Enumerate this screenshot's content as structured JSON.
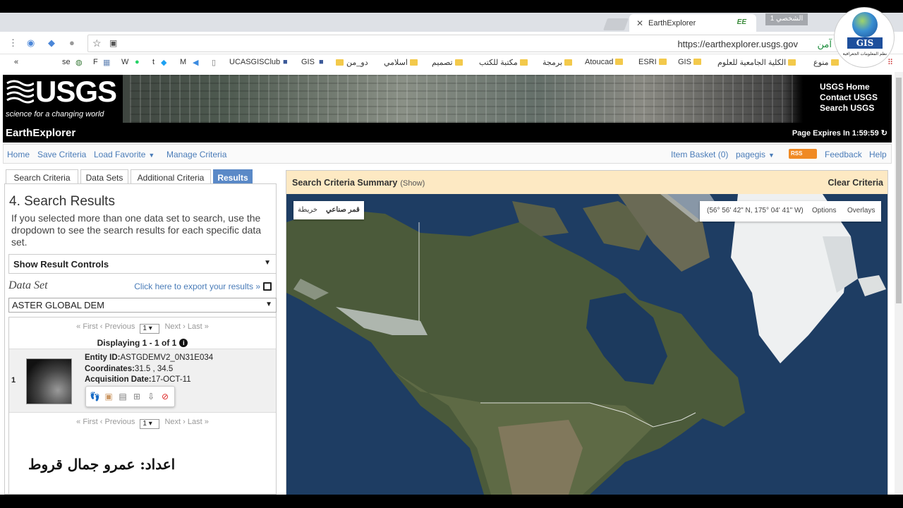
{
  "browser": {
    "tab_title": "EarthExplorer",
    "tab_badge": "EE",
    "profile_label": "الشخصي 1",
    "url": "https://earthexplorer.usgs.gov",
    "secure_label": "آمن",
    "bookmarks": [
      "se",
      "F",
      "W",
      "t",
      "M",
      "UCASGISClub",
      "GIS",
      "دو_من",
      "اسلامي",
      "تصميم",
      "مكتبة للكتب",
      "برمجة",
      "Atoucad",
      "ESRI",
      "GIS",
      "الكلية الجامعية للعلوم",
      "منوع"
    ],
    "overflow": "«"
  },
  "logo_overlay": {
    "text": "GIS",
    "subtitle": "نظم المعلومات الجغرافية"
  },
  "usgs": {
    "wordmark": "USGS",
    "tagline": "science for a changing world",
    "links": [
      "USGS Home",
      "Contact USGS",
      "Search USGS"
    ]
  },
  "app": {
    "title": "EarthExplorer",
    "expires": "Page Expires In 1:59:59",
    "nav_left": [
      "Home",
      "Save Criteria",
      "Load Favorite",
      "Manage Criteria"
    ],
    "item_basket": "Item Basket (0)",
    "user": "pagegis",
    "rss": "RSS",
    "feedback": "Feedback",
    "help": "Help"
  },
  "tabs": [
    "Search Criteria",
    "Data Sets",
    "Additional Criteria",
    "Results"
  ],
  "results": {
    "heading": "4. Search Results",
    "description": "If you selected more than one data set to search, use the dropdown to see the search results for each specific data set.",
    "show_controls": "Show Result Controls",
    "dataset_label": "Data Set",
    "export_link": "Click here to export your results »",
    "dataset_value": "ASTER GLOBAL DEM",
    "pager": {
      "first": "« First",
      "previous": "‹ Previous",
      "page": "1",
      "next": "Next ›",
      "last": "Last »"
    },
    "displaying": "Displaying 1 - 1 of 1",
    "rows": [
      {
        "index": "1",
        "entity_label": "Entity ID:",
        "entity_id": "ASTGDEMV2_0N31E034",
        "coords_label": "Coordinates:",
        "coords": "31.5 , 34.5",
        "date_label": "Acquisition Date:",
        "date": "17-OCT-11"
      }
    ]
  },
  "criteria": {
    "title": "Search Criteria Summary",
    "show": "(Show)",
    "clear": "Clear Criteria"
  },
  "map": {
    "type_options": [
      "خريطة",
      "قمر صناعي"
    ],
    "coordinates": "(56° 56' 42\" N, 175° 04' 41\" W)",
    "options": "Options",
    "overlays": "Overlays"
  },
  "watermark": "اعداد: عمرو جمال قروط"
}
